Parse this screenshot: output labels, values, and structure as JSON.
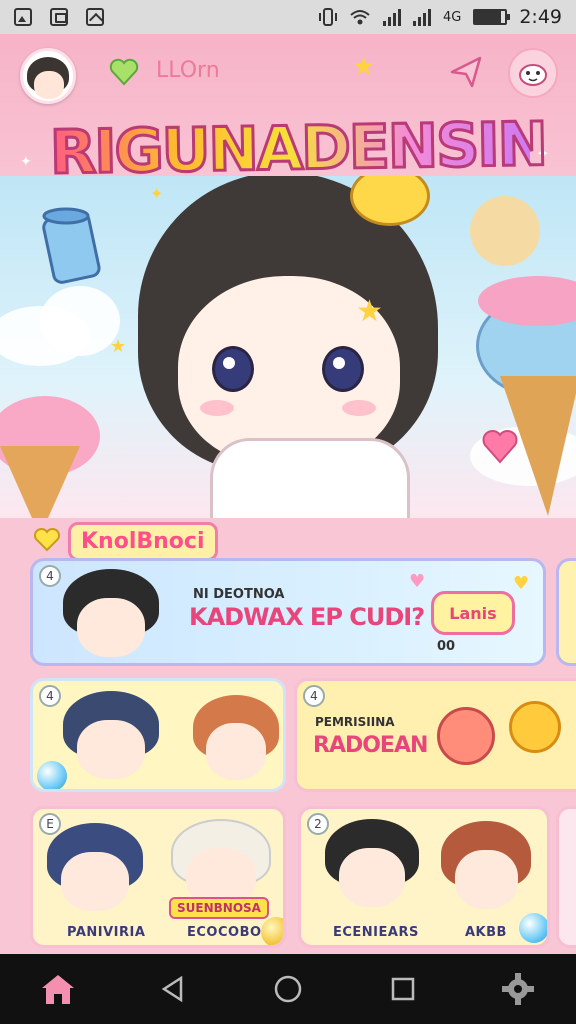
{
  "status_bar": {
    "time": "2:49",
    "signal_text": "4G",
    "battery_level": 0.85
  },
  "header": {
    "subtitle": "LLOrn",
    "title": "RIGUNADENSIN"
  },
  "section": {
    "label": "KnolBnoci"
  },
  "cards": [
    {
      "number": "4",
      "line1": "NI DEOTNOA",
      "line2": "KADWAX EP CUDI?",
      "badge": "Lanis",
      "badge_sub": "00"
    },
    {
      "number": "4",
      "title_sub": "PEMRISIINA",
      "title": "RADOEAN"
    },
    {
      "number": "E",
      "tag_left": "PANIVIRIA",
      "banner": "SUENBNOSA",
      "tag_right": "ECOCOBO"
    },
    {
      "number": "2",
      "tag_left": "ECENIEARS",
      "tag_right": "AKBB"
    }
  ],
  "nav": {
    "home": "home",
    "back": "back",
    "circle": "home-circle",
    "recent": "recent",
    "settings": "settings"
  },
  "colors": {
    "accent_pink": "#f07dab",
    "title_stroke": "#b83a77",
    "status_bg": "#dcdcdc",
    "nav_bg": "#111111"
  }
}
